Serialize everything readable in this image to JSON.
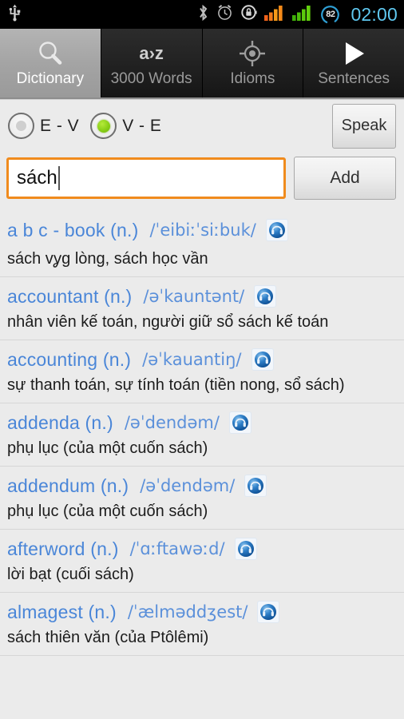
{
  "statusbar": {
    "time": "02:00",
    "battery_level": "82",
    "icons": [
      "usb-icon",
      "bluetooth-icon",
      "alarm-icon",
      "rotation-lock-icon",
      "signal-icon-1",
      "signal-icon-2",
      "battery-icon"
    ],
    "colors": {
      "time": "#5fc8f0",
      "signal_1": "#f26c1b",
      "signal_2": "#53c10b",
      "battery_ring": "#2f9fd4"
    }
  },
  "tabs": [
    {
      "label": "Dictionary",
      "icon": "magnifier-icon",
      "active": true
    },
    {
      "label": "3000 Words",
      "icon": "a-to-z-icon",
      "icon_text": "a›z",
      "active": false
    },
    {
      "label": "Idioms",
      "icon": "target-icon",
      "active": false
    },
    {
      "label": "Sentences",
      "icon": "play-icon",
      "active": false
    }
  ],
  "mode": {
    "options": [
      {
        "label": "E - V",
        "checked": false
      },
      {
        "label": "V - E",
        "checked": true
      }
    ],
    "speak_label": "Speak",
    "selected_color": "#85cc14"
  },
  "search": {
    "value": "sách",
    "placeholder": "",
    "add_label": "Add",
    "focus_color": "#f08b1d"
  },
  "results": [
    {
      "term": "a b c - book (n.)",
      "phonetic": "/ˈeibiːˈsiːbuk/",
      "definition": "sách vỿg lòng, sách học vần",
      "audio": "headphones-icon"
    },
    {
      "term": "accountant (n.)",
      "phonetic": "/əˈkauntənt/",
      "definition": "nhân viên kế toán, người giữ sổ sách kế toán",
      "audio": "headphones-icon"
    },
    {
      "term": "accounting (n.)",
      "phonetic": "/əˈkauantiŋ/",
      "definition": "sự thanh toán, sự tính toán (tiền nong, sổ sách)",
      "audio": "headphones-icon"
    },
    {
      "term": "addenda (n.)",
      "phonetic": "/əˈdendəm/",
      "definition": "phụ lục (của một cuốn sách)",
      "audio": "headphones-icon"
    },
    {
      "term": "addendum (n.)",
      "phonetic": "/əˈdendəm/",
      "definition": "phụ lục (của một cuốn sách)",
      "audio": "headphones-icon"
    },
    {
      "term": "afterword (n.)",
      "phonetic": "/ˈɑːftawəːd/",
      "definition": "lời bạt (cuối sách)",
      "audio": "headphones-icon"
    },
    {
      "term": "almagest (n.)",
      "phonetic": "/ˈælməddʒest/",
      "definition": "sách thiên văn (của Ptôlêmi)",
      "audio": "headphones-icon"
    }
  ]
}
